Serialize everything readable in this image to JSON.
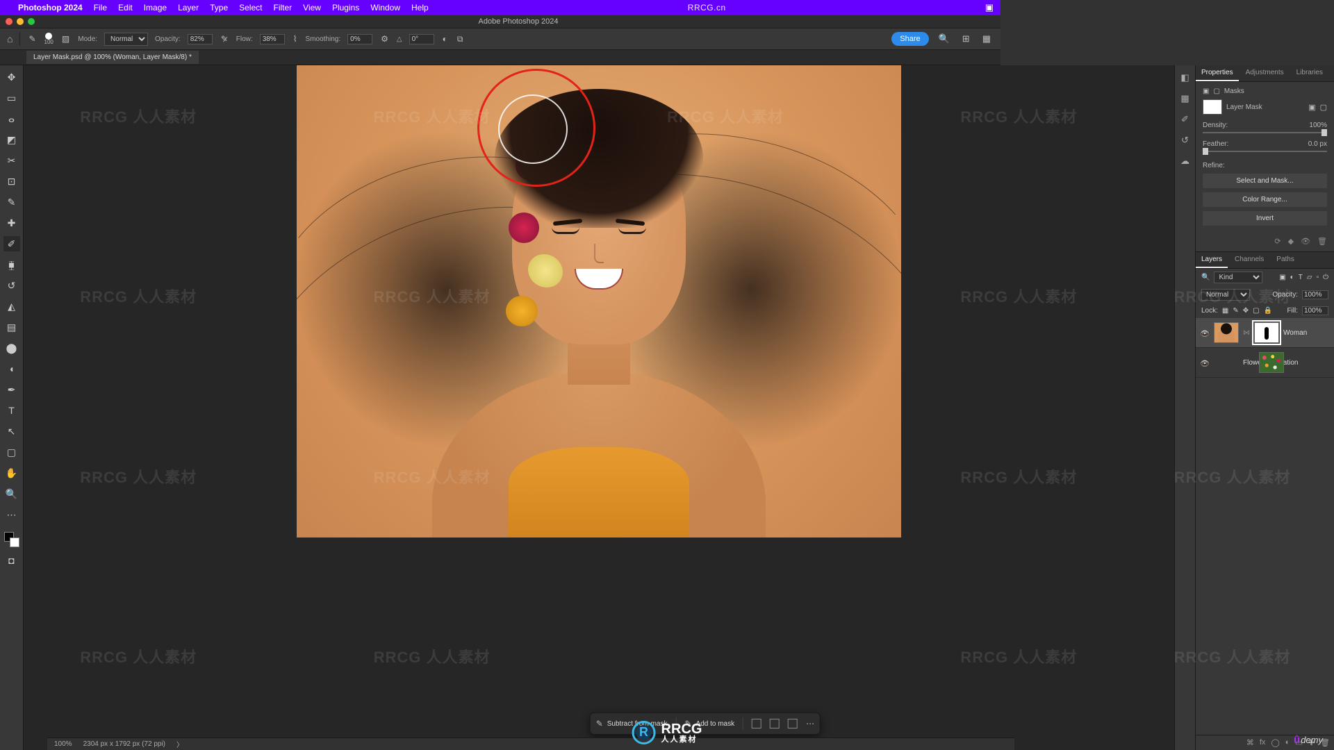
{
  "menu": {
    "app_name": "Photoshop 2024",
    "items": [
      "File",
      "Edit",
      "Image",
      "Layer",
      "Type",
      "Select",
      "Filter",
      "View",
      "Plugins",
      "Window",
      "Help"
    ],
    "url_overlay": "RRCG.cn"
  },
  "window_title": "Adobe Photoshop 2024",
  "options_bar": {
    "brush_size": "100",
    "mode_label": "Mode:",
    "mode_value": "Normal",
    "opacity_label": "Opacity:",
    "opacity_value": "82%",
    "flow_label": "Flow:",
    "flow_value": "38%",
    "smoothing_label": "Smoothing:",
    "smoothing_value": "0%",
    "angle_label": "△",
    "angle_value": "0°",
    "share_label": "Share"
  },
  "doc_tab": "Layer Mask.psd @ 100% (Woman, Layer Mask/8) *",
  "taskbar": {
    "subtract": "Subtract from mask",
    "add": "Add to mask"
  },
  "panels": {
    "properties_tabs": [
      "Properties",
      "Adjustments",
      "Libraries"
    ],
    "masks_label": "Masks",
    "mask_name": "Layer Mask",
    "density_label": "Density:",
    "density_value": "100%",
    "feather_label": "Feather:",
    "feather_value": "0.0 px",
    "refine_label": "Refine:",
    "btn_select_mask": "Select and Mask...",
    "btn_color_range": "Color Range...",
    "btn_invert": "Invert",
    "layers_tabs": [
      "Layers",
      "Channels",
      "Paths"
    ],
    "kind_label": "Kind",
    "blend_mode": "Normal",
    "lay_opacity_label": "Opacity:",
    "lay_opacity_value": "100%",
    "lock_label": "Lock:",
    "fill_label": "Fill:",
    "fill_value": "100%",
    "layers": [
      {
        "name": "Woman"
      },
      {
        "name": "Flower decoration"
      }
    ]
  },
  "status": {
    "zoom": "100%",
    "dims": "2304 px x 1792 px (72 ppi)"
  },
  "watermark": {
    "text": "RRCG\n人人素材",
    "brand_big": "RRCG",
    "brand_small": "人人素材",
    "udemy": "ûdemy"
  }
}
